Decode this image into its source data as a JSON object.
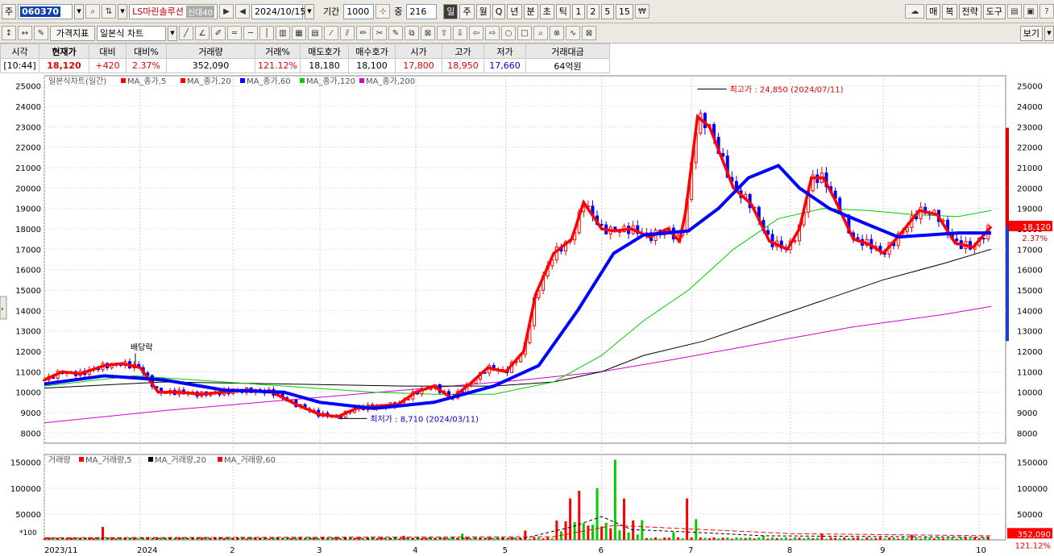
{
  "toolbar1": {
    "mode_label": "주",
    "stock_code": "060370",
    "stock_name": "LS마린솔루션",
    "credit_tag": "신대40",
    "date": "2024/10/15",
    "period_label": "기간",
    "period_value": "1000",
    "count_label": "중",
    "count_value": "216",
    "timeframes": [
      "일",
      "주",
      "월",
      "Q",
      "년",
      "분",
      "초",
      "틱",
      "1",
      "2",
      "5",
      "15"
    ],
    "active_timeframe": "일",
    "right_buttons": [
      "매",
      "복",
      "전략",
      "도구"
    ]
  },
  "toolbar2": {
    "indicator_button": "가격지표",
    "chart_type": "일본식 차트",
    "view_button": "보기"
  },
  "quote": {
    "headers": [
      "시각",
      "현재가",
      "대비",
      "대비%",
      "거래량",
      "거래%",
      "매도호가",
      "매수호가",
      "시가",
      "고가",
      "저가",
      "거래대금"
    ],
    "values": [
      "[10:44]",
      "18,120",
      "+420",
      "2.37%",
      "352,090",
      "121.12%",
      "18,180",
      "18,100",
      "17,800",
      "18,950",
      "17,660",
      "64억원"
    ]
  },
  "chart_data": [
    {
      "type": "candlestick",
      "legend": [
        "일본식차트(일간)",
        "MA_종가,5",
        "MA_종가,20",
        "MA_종가,60",
        "MA_종가,120",
        "MA_종가,200"
      ],
      "colors": {
        "ma5": "#ff0000",
        "ma20": "#ff0000",
        "ma60": "#0000ff",
        "ma120": "#00cc00",
        "ma200": "#d000d0",
        "ma200_line": "#000000",
        "up": "#ff0000",
        "down": "#0000ff"
      },
      "ylim": [
        7500,
        25500
      ],
      "yticks": [
        8000,
        9000,
        10000,
        11000,
        12000,
        13000,
        14000,
        15000,
        16000,
        17000,
        18000,
        19000,
        20000,
        21000,
        22000,
        23000,
        24000,
        25000
      ],
      "x_labels": [
        "2023/11",
        "2024",
        "2",
        "3",
        "4",
        "5",
        "6",
        "7",
        "8",
        "9",
        "10"
      ],
      "x_label_days": [
        0,
        32,
        63,
        92,
        124,
        154,
        186,
        216,
        249,
        280,
        312
      ],
      "annotations": {
        "high": "최고가 : 24,850 (2024/07/11)",
        "low": "최저가 : 8,710 (2024/03/11)",
        "dividend": "배당락"
      },
      "current_price": "18,120",
      "current_change": "2.37%",
      "closes": [
        [
          0,
          10600
        ],
        [
          6,
          11000
        ],
        [
          12,
          10900
        ],
        [
          20,
          11300
        ],
        [
          26,
          11400
        ],
        [
          32,
          11200
        ],
        [
          38,
          10000
        ],
        [
          45,
          10000
        ],
        [
          52,
          9900
        ],
        [
          60,
          10000
        ],
        [
          68,
          10100
        ],
        [
          76,
          10000
        ],
        [
          84,
          9400
        ],
        [
          92,
          8900
        ],
        [
          98,
          8800
        ],
        [
          104,
          9200
        ],
        [
          110,
          9300
        ],
        [
          118,
          9400
        ],
        [
          124,
          10000
        ],
        [
          130,
          10300
        ],
        [
          136,
          9700
        ],
        [
          142,
          10400
        ],
        [
          148,
          11200
        ],
        [
          154,
          11000
        ],
        [
          160,
          12000
        ],
        [
          164,
          14800
        ],
        [
          170,
          16800
        ],
        [
          176,
          17500
        ],
        [
          180,
          19300
        ],
        [
          186,
          18000
        ],
        [
          190,
          17900
        ],
        [
          196,
          18000
        ],
        [
          202,
          17600
        ],
        [
          208,
          18000
        ],
        [
          212,
          17400
        ],
        [
          214,
          18800
        ],
        [
          218,
          23500
        ],
        [
          222,
          23000
        ],
        [
          226,
          21500
        ],
        [
          230,
          20000
        ],
        [
          236,
          19200
        ],
        [
          242,
          17400
        ],
        [
          248,
          17000
        ],
        [
          252,
          18000
        ],
        [
          256,
          20500
        ],
        [
          260,
          20500
        ],
        [
          264,
          19400
        ],
        [
          270,
          17500
        ],
        [
          276,
          17200
        ],
        [
          280,
          16800
        ],
        [
          286,
          17800
        ],
        [
          292,
          18900
        ],
        [
          298,
          18700
        ],
        [
          304,
          17300
        ],
        [
          310,
          17100
        ],
        [
          316,
          18120
        ]
      ],
      "ma20": [
        [
          0,
          10400
        ],
        [
          20,
          10800
        ],
        [
          40,
          10600
        ],
        [
          60,
          10100
        ],
        [
          80,
          10000
        ],
        [
          92,
          9500
        ],
        [
          110,
          9200
        ],
        [
          130,
          9500
        ],
        [
          150,
          10300
        ],
        [
          165,
          11300
        ],
        [
          178,
          14000
        ],
        [
          190,
          16800
        ],
        [
          200,
          17700
        ],
        [
          215,
          17900
        ],
        [
          225,
          19000
        ],
        [
          235,
          20500
        ],
        [
          245,
          21100
        ],
        [
          252,
          20000
        ],
        [
          262,
          19000
        ],
        [
          275,
          18200
        ],
        [
          285,
          17600
        ],
        [
          295,
          17700
        ],
        [
          305,
          17800
        ],
        [
          316,
          17800
        ]
      ],
      "ma60": [
        [
          0,
          10300
        ],
        [
          30,
          10800
        ],
        [
          60,
          10500
        ],
        [
          90,
          10200
        ],
        [
          110,
          10000
        ],
        [
          130,
          9900
        ],
        [
          150,
          9900
        ],
        [
          170,
          10500
        ],
        [
          186,
          11800
        ],
        [
          200,
          13500
        ],
        [
          215,
          15000
        ],
        [
          230,
          17000
        ],
        [
          245,
          18500
        ],
        [
          260,
          19000
        ],
        [
          275,
          18900
        ],
        [
          290,
          18700
        ],
        [
          305,
          18600
        ],
        [
          316,
          18900
        ]
      ],
      "ma120": [
        [
          0,
          10200
        ],
        [
          40,
          10500
        ],
        [
          80,
          10400
        ],
        [
          120,
          10300
        ],
        [
          150,
          10300
        ],
        [
          170,
          10500
        ],
        [
          186,
          11000
        ],
        [
          200,
          11800
        ],
        [
          220,
          12500
        ],
        [
          240,
          13500
        ],
        [
          260,
          14500
        ],
        [
          280,
          15500
        ],
        [
          300,
          16300
        ],
        [
          316,
          17000
        ]
      ],
      "ma200": [
        [
          0,
          8500
        ],
        [
          40,
          9100
        ],
        [
          80,
          9600
        ],
        [
          120,
          10100
        ],
        [
          160,
          10600
        ],
        [
          186,
          11000
        ],
        [
          210,
          11600
        ],
        [
          240,
          12400
        ],
        [
          270,
          13200
        ],
        [
          300,
          13800
        ],
        [
          316,
          14200
        ]
      ]
    },
    {
      "type": "bar",
      "legend": [
        "거래량",
        "MA_거래량,5",
        "MA_거래량,20",
        "MA_거래량,60"
      ],
      "ylim": [
        0,
        165000
      ],
      "yticks": [
        50000,
        100000,
        150000
      ],
      "unit_label": "*100",
      "current_volume": "352,090",
      "current_volume_pct": "121.12%",
      "spikes": [
        [
          20,
          25000
        ],
        [
          120,
          8000
        ],
        [
          140,
          12000
        ],
        [
          160,
          18000
        ],
        [
          175,
          80000
        ],
        [
          178,
          95000
        ],
        [
          185,
          100000
        ],
        [
          190,
          155000
        ],
        [
          193,
          80000
        ],
        [
          210,
          15000
        ],
        [
          214,
          80000
        ],
        [
          218,
          40000
        ],
        [
          240,
          8000
        ],
        [
          260,
          12000
        ],
        [
          290,
          10000
        ]
      ]
    }
  ]
}
